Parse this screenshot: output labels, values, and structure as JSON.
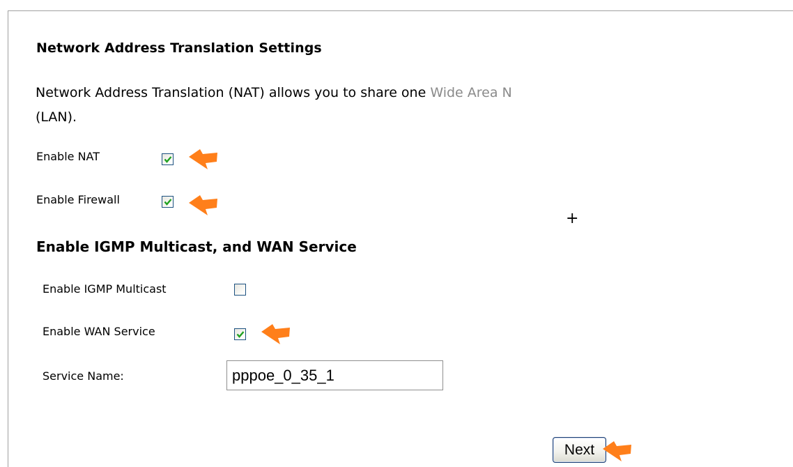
{
  "nat": {
    "heading": "Network Address Translation Settings",
    "description_main": "Network Address Translation (NAT) allows you to share one ",
    "description_faded": "Wide Area N",
    "description_line2": "(LAN).",
    "enable_nat_label": "Enable NAT",
    "enable_nat_checked": true,
    "enable_firewall_label": "Enable Firewall",
    "enable_firewall_checked": true
  },
  "wan": {
    "heading": "Enable IGMP Multicast, and WAN Service",
    "igmp_label": "Enable IGMP Multicast",
    "igmp_checked": false,
    "wan_service_label": "Enable WAN Service",
    "wan_service_checked": true,
    "service_name_label": "Service Name:",
    "service_name_value": "pppoe_0_35_1"
  },
  "actions": {
    "next_label": "Next"
  },
  "colors": {
    "annotation_arrow": "#ff7f1a",
    "checkbox_border": "#1c5180",
    "checkmark": "#21a121"
  },
  "icons": {
    "annotation": "orange-arrow-pointer-icon",
    "checkmark": "checkmark-icon",
    "cursor": "crosshair-cursor-icon"
  }
}
